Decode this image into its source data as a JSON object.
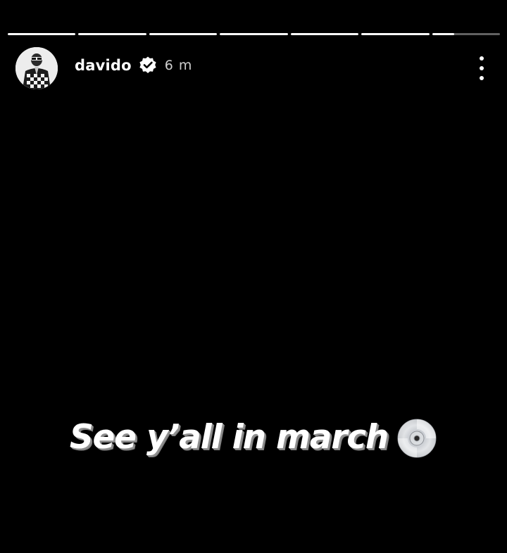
{
  "story": {
    "progress": {
      "segments": [
        1,
        1,
        1,
        1,
        1,
        1,
        0.33
      ]
    },
    "author": {
      "username": "davido",
      "verified": true,
      "timestamp": "6 m",
      "avatar_icon": "profile-avatar-icon"
    },
    "menu_icon": "more-vertical-icon",
    "caption": {
      "text": "See y’all in march",
      "emoji_icon": "optical-disc-icon"
    },
    "colors": {
      "background": "#000000",
      "text": "#ffffff",
      "progress_track": "#5c5c5c",
      "progress_fill": "#ffffff"
    }
  }
}
